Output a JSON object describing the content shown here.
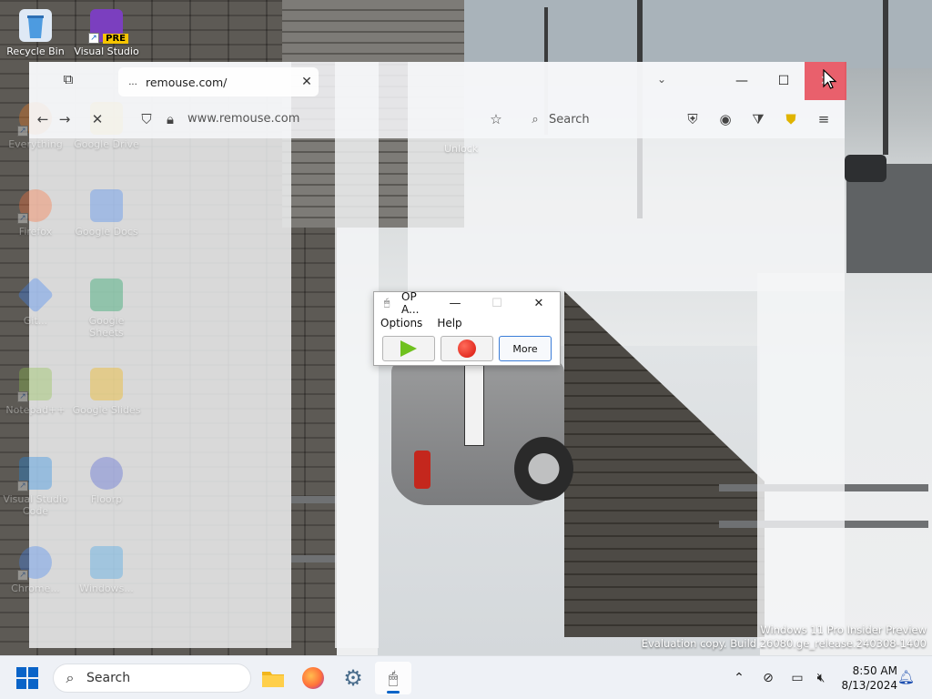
{
  "desktop": {
    "icons": [
      {
        "label": "Recycle Bin",
        "icon": "recycle-bin-icon",
        "color": "#2d7fd3"
      },
      {
        "label": "Visual Studio",
        "icon": "visual-studio-icon",
        "badge": "PRE",
        "color": "#7b3fbf"
      },
      {
        "label": "Everything",
        "icon": "everything-icon",
        "color": "#f07c1f"
      },
      {
        "label": "Google Drive",
        "icon": "google-drive-icon",
        "color": "#f4c20d"
      },
      {
        "label": "Firefox",
        "icon": "firefox-icon",
        "color": "#ff7139"
      },
      {
        "label": "Google Docs",
        "icon": "google-docs-icon",
        "color": "#4285f4"
      },
      {
        "label": "Git...",
        "icon": "git-icon",
        "color": "#3b82f6"
      },
      {
        "label": "Google Sheets",
        "icon": "google-sheets-icon",
        "color": "#0f9d58"
      },
      {
        "label": "Notepad++",
        "icon": "notepad-plus-plus-icon",
        "color": "#8fc24a"
      },
      {
        "label": "Google Slides",
        "icon": "google-slides-icon",
        "color": "#f4b400"
      },
      {
        "label": "Visual Studio Code",
        "icon": "vscode-icon",
        "color": "#1e88e5"
      },
      {
        "label": "Floorp",
        "icon": "floorp-icon",
        "color": "#4a5cd6"
      },
      {
        "label": "Chrome...",
        "icon": "chrome-icon",
        "color": "#4285f4"
      },
      {
        "label": "Windows...",
        "icon": "windows-app-icon",
        "color": "#3aa0e8"
      }
    ]
  },
  "browser": {
    "tab_title": "remouse.com/",
    "tab_favicon": "...",
    "url": "www.remouse.com",
    "search_label": "Search",
    "ghost_label": "Unlock"
  },
  "op_window": {
    "title": "OP A...",
    "menu": [
      "Options",
      "Help"
    ],
    "more_label": "More",
    "minimize": "—",
    "maximize": "☐",
    "close": "✕"
  },
  "watermark": {
    "line1": "Windows 11 Pro Insider Preview",
    "line2": "Evaluation copy. Build 26080.ge_release.240308-1400"
  },
  "taskbar": {
    "search_label": "Search",
    "time": "8:50 AM",
    "date": "8/13/2024"
  }
}
